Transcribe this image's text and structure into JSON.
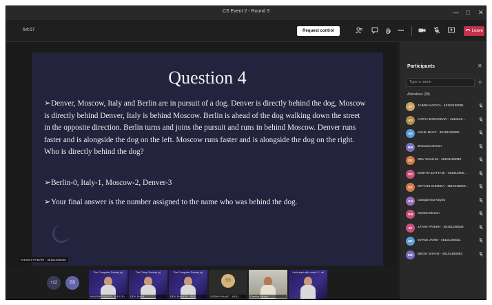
{
  "window": {
    "title": "CS Event 2 - Round 3",
    "controls": [
      "—",
      "□",
      "✕"
    ]
  },
  "toolbar": {
    "timer": "54:07",
    "request_control_label": "Request control",
    "leave_label": "Leave",
    "icons": [
      "people-icon",
      "chat-icon",
      "raise-hand-icon",
      "more-icon",
      "camera-icon",
      "mic-off-icon",
      "share-icon",
      "phone-icon"
    ]
  },
  "slide": {
    "title": "Question 4",
    "bullet_arrow": "➢",
    "bullet1": "Denver, Moscow, Italy and Berlin are in pursuit of a dog. Denver is directly behind the dog, Moscow is directly behind Denver, Italy is behind Moscow. Berlin is ahead of the dog walking down the street in the opposite direction. Berlin turns and joins the pursuit and runs in behind Moscow. Denver runs faster and is alongside the dog on the left. Moscow runs faster and is alongside the dog on the right. Who is directly behind the dog?",
    "bullet2": "Berlin-0, Italy-1, Moscow-2, Denver-3",
    "bullet3": "Your final answer is the number assigned to the name who was behind the dog."
  },
  "presenter_tag": "KHUSHI PABARI - 45101190005",
  "strip": {
    "more_count": "+22",
    "ss_initials": "SS",
    "tiles": [
      {
        "head": "The Computer Society (s)",
        "name": "KHUSHI PABARI - 4510110...",
        "kind": "person"
      },
      {
        "head": "The Comp   Society (s)",
        "name": "DEV SHAH",
        "kind": "person"
      },
      {
        "head": "The Computer Society (s)",
        "name": "DEV SHAH16 - 4510...",
        "kind": "person"
      },
      {
        "head": "",
        "name": "SIDDHI SHAH7 - 4510...",
        "kind": "avatar",
        "initials": "SS"
      },
      {
        "head": "",
        "name": "Geetha Menon",
        "kind": "room"
      },
      {
        "head": "Let's start with round 3 - all",
        "name": "",
        "kind": "person"
      }
    ]
  },
  "participants": {
    "title": "Participants",
    "search_placeholder": "Type a name",
    "attendees_label": "Attendees (28)",
    "items": [
      {
        "initials": "JV",
        "name": "JAIMIN VAIDYA - 45101190091",
        "color": "#c8a166"
      },
      {
        "initials": "AD",
        "name": "AARYA DIWADKAR - 4510119...",
        "color": "#b58b4c"
      },
      {
        "initials": "AB",
        "name": "AKHIL BHAT - 45101190065",
        "color": "#5b9bd5"
      },
      {
        "initials": "BM",
        "name": "Bhavana Menon",
        "color": "#7a6fc1"
      },
      {
        "initials": "DS",
        "name": "DEV SHAH16 - 45101190080",
        "color": "#d07a45"
      },
      {
        "initials": "DD",
        "name": "DISHITA DATTANI - 451011900...",
        "color": "#c94f7c"
      },
      {
        "initials": "DS",
        "name": "DIVYAM SUREKA - 4510119000...",
        "color": "#d07a45"
      },
      {
        "initials": "GN",
        "name": "Gangamma Nayak",
        "color": "#9b6fc1"
      },
      {
        "initials": "GM",
        "name": "Geetha Menon",
        "color": "#c94f7c"
      },
      {
        "initials": "JP",
        "name": "JATAN PARIKH - 45101190046",
        "color": "#c94f7c"
      },
      {
        "initials": "MJ",
        "name": "MANSI JAIN5 - 45101190031",
        "color": "#5b9bd5"
      },
      {
        "initials": "MS",
        "name": "MEGH SHAH2 - 45101190083",
        "color": "#7a6fc1"
      }
    ]
  }
}
